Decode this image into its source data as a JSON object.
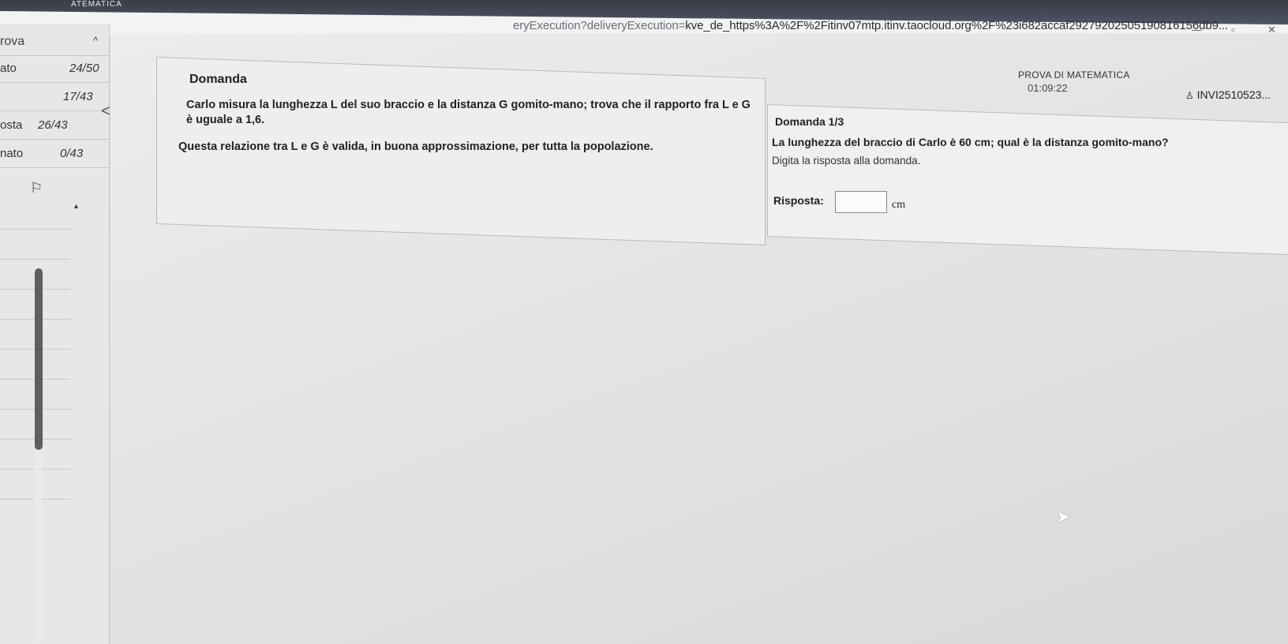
{
  "browser": {
    "tab_title": "ATEMATICA",
    "url_path": "eryExecution?deliveryExecution=",
    "url_main": "kve_de_https%3A%2F%2Fitinv07mtp.itinv.taocloud.org%2F%23i682accaf29279202505190816156db9..."
  },
  "sidebar": {
    "header_label": "rova",
    "rows": [
      {
        "label": "ato",
        "value": "24/50"
      },
      {
        "label": "",
        "value": "17/43"
      },
      {
        "label": "osta",
        "value": "26/43"
      },
      {
        "label": "nato",
        "value": "0/43"
      }
    ]
  },
  "header": {
    "exam_title": "PROVA DI MATEMATICA",
    "timer": "01:09:22",
    "user_id": "INVI2510523..."
  },
  "left_panel": {
    "label": "Domanda",
    "text1": "Carlo misura la lunghezza L del suo braccio e la distanza G gomito-mano; trova che il rapporto fra L e G è uguale a 1,6.",
    "text2": "Questa relazione tra L e G è valida, in buona approssimazione, per tutta la popolazione."
  },
  "right_panel": {
    "label": "Domanda 1/3",
    "question": "La lunghezza del braccio di Carlo è 60 cm; qual è la distanza gomito-mano?",
    "hint": "Digita la risposta alla domanda.",
    "answer_label": "Risposta:",
    "answer_value": "",
    "unit": "cm"
  }
}
